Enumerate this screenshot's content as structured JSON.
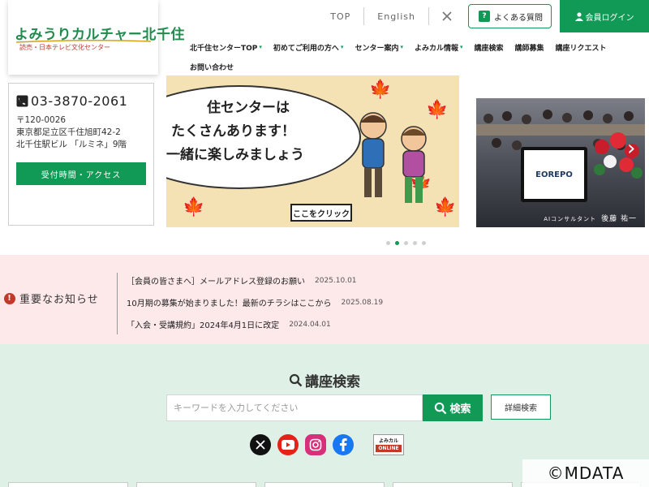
{
  "logo": {
    "main": "よみうりカルチャー北千住",
    "sub": "読売・日本テレビ文化センター"
  },
  "topbar": {
    "top": "TOP",
    "english": "English",
    "faq": "よくある質問",
    "login": "会員ログイン"
  },
  "nav": [
    {
      "label": "北千住センターTOP",
      "caret": "▾"
    },
    {
      "label": "初めてご利用の方へ",
      "caret": "▾"
    },
    {
      "label": "センター案内",
      "caret": "▾"
    },
    {
      "label": "よみカル情報",
      "caret": "▾"
    },
    {
      "label": "講座検索",
      "caret": ""
    },
    {
      "label": "講師募集",
      "caret": ""
    },
    {
      "label": "講座リクエスト",
      "caret": ""
    },
    {
      "label": "お問い合わせ",
      "caret": ""
    }
  ],
  "contact": {
    "phone": "03-3870-2061",
    "postal": "〒120-0026",
    "address1": "東京都足立区千住旭町42-2",
    "address2": "北千住駅ビル 「ルミネ」9階",
    "access": "受付時間・アクセス"
  },
  "slides": {
    "a": {
      "line1": "住センターは",
      "line2": "たくさんあります！",
      "line3": "一緒に楽しみましょう",
      "click": "ここをクリック"
    },
    "b": {
      "logo": "EOREPO",
      "caption_small": "AIコンサルタント",
      "caption_name": "後藤 祐一"
    },
    "prev": "‹",
    "next": "›"
  },
  "notices": {
    "heading": "重要なお知らせ",
    "items": [
      {
        "text": "［会員の皆さまへ］メールアドレス登録のお願い",
        "date": "2025.10.01"
      },
      {
        "text": "10月期の募集が始まりました！最新のチラシはここから",
        "date": "2025.08.19"
      },
      {
        "text": "「入会・受講規約」2024年4月1日に改定",
        "date": "2024.04.01"
      }
    ]
  },
  "search": {
    "title": "講座検索",
    "placeholder": "キーワードを入力してください",
    "button": "検索",
    "advanced": "詳細検索",
    "online_top": "よみカル",
    "online_bottom": "ONLINE"
  },
  "watermark": "©MDATA",
  "colors": {
    "brand_green": "#109a55",
    "notice_bg": "#fde9ea",
    "search_bg": "#dff1e6",
    "alert_red": "#c0392b"
  }
}
